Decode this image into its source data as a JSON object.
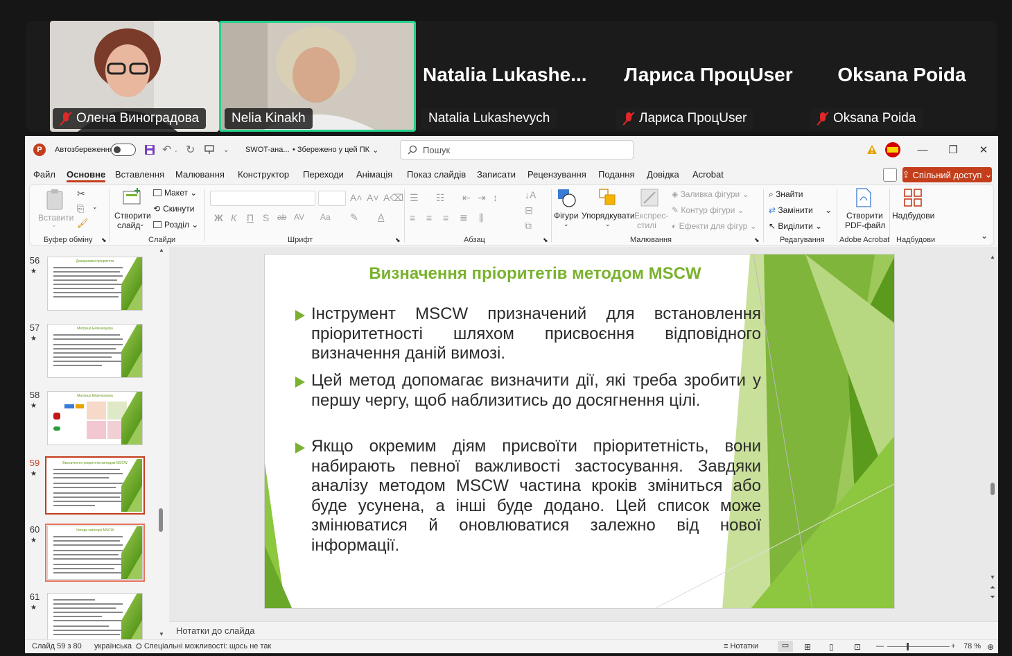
{
  "meeting": {
    "participants": [
      {
        "name": "Олена Виноградова",
        "muted": true,
        "video": true
      },
      {
        "name": "Nelia Kinakh",
        "muted": false,
        "video": true,
        "active_speaker": true
      },
      {
        "name": "Natalia Lukashevych",
        "display_name": "Natalia  Lukashe...",
        "muted": false,
        "video": false
      },
      {
        "name": "Лариса ПроцUser",
        "display_name": "Лариса ПроцUser",
        "muted": true,
        "video": false
      },
      {
        "name": "Oksana Poida",
        "display_name": "Oksana Poida",
        "muted": true,
        "video": false
      }
    ],
    "colors": {
      "active_border": "#23d18b",
      "muted": "#e02828"
    }
  },
  "app": {
    "autosave_label": "Автозбереження",
    "file_name": "SWOT-ана...",
    "save_status": "• Збережено у цей ПК",
    "search_placeholder": "Пошук",
    "accent": "#c43e1c",
    "share_label": "Спільний доступ"
  },
  "tabs": [
    "Файл",
    "Основне",
    "Вставлення",
    "Малювання",
    "Конструктор",
    "Переходи",
    "Анімація",
    "Показ слайдів",
    "Записати",
    "Рецензування",
    "Подання",
    "Довідка",
    "Acrobat"
  ],
  "ribbon": {
    "clipboard": {
      "paste": "Вставити",
      "label": "Буфер обміну"
    },
    "slides": {
      "new_slide": "Створити",
      "new_slide2": "слайд",
      "layout": "Макет",
      "reset": "Скинути",
      "section": "Розділ",
      "label": "Слайди"
    },
    "font": {
      "label": "Шрифт",
      "bold": "Ж",
      "italic": "К",
      "underline": "П",
      "strike": "S",
      "strike2": "ab",
      "spacing": "AV",
      "case": "Aa"
    },
    "paragraph": {
      "label": "Абзац"
    },
    "drawing": {
      "shapes": "Фігури",
      "arrange": "Упорядкувати",
      "quick_styles": "Експрес-",
      "quick_styles2": "стилі",
      "fill": "Заливка фігури",
      "outline": "Контур фігури",
      "effects": "Ефекти для фігур",
      "label": "Малювання"
    },
    "editing": {
      "find": "Знайти",
      "replace": "Замінити",
      "select": "Виділити",
      "label": "Редагування"
    },
    "acrobat": {
      "create_pdf": "Створити",
      "create_pdf2": "PDF-файл",
      "label": "Adobe Acrobat"
    },
    "addins": {
      "button": "Надбудови",
      "label": "Надбудови"
    }
  },
  "thumbnails": [
    {
      "number": "56",
      "title": "Декаративні пріоритети"
    },
    {
      "number": "57",
      "title": "Матриця Ейзенхауера"
    },
    {
      "number": "58",
      "title": "Матриця Ейзенхауера"
    },
    {
      "number": "59",
      "title": "Визначення пріоритетів методом MSCW",
      "selected": true
    },
    {
      "number": "60",
      "title": "Чотири категорії MSCW"
    },
    {
      "number": "61",
      "title": ""
    }
  ],
  "slide": {
    "title": "Визначення пріоритетів методом MSCW",
    "bullets": [
      "Інструмент MSCW призначений для встановлення пріоритетності шляхом присвоєння відповідного визначення даній вимозі.",
      "Цей метод допомагає визначити дії, які треба зробити у першу чергу, щоб наблизитись до досягнення цілі.",
      "Якщо окремим діям присвоїти пріоритетність, вони набирають певної важливості застосування. Завдяки аналізу методом MSCW частина кроків зміниться або буде усунена, а інші буде додано. Цей список може змінюватися й оновлюватися залежно від нової інформації."
    ],
    "title_color": "#7ab22e"
  },
  "notes_placeholder": "Нотатки до слайда",
  "status": {
    "slide_counter": "Слайд 59 з 80",
    "language": "українська",
    "accessibility": "Спеціальні можливості: щось не так",
    "notes": "Нотатки",
    "zoom": "78 %"
  }
}
